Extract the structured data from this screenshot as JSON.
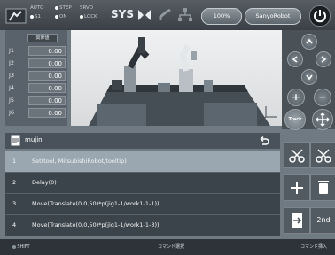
{
  "topbar": {
    "modes": [
      {
        "label": "AUTO",
        "active": false
      },
      {
        "label": "S1",
        "active": true
      },
      {
        "label": "STEP",
        "active": false
      },
      {
        "label": "ON",
        "active": true
      },
      {
        "label": "LOCK",
        "active": false
      },
      {
        "label": "SRVO",
        "active": false
      }
    ],
    "sys_label": "SYS",
    "speed_label": "100%",
    "robot_label": "SanyoRobot"
  },
  "joints": {
    "header": "関節値",
    "items": [
      {
        "label": "J1",
        "value": "0.00"
      },
      {
        "label": "J2",
        "value": "0.00"
      },
      {
        "label": "J3",
        "value": "0.00"
      },
      {
        "label": "J4",
        "value": "0.00"
      },
      {
        "label": "J5",
        "value": "0.00"
      },
      {
        "label": "J6",
        "value": "0.00"
      }
    ]
  },
  "controls": {
    "track_label": "Track",
    "plus": "+",
    "minus": "−"
  },
  "program": {
    "title": "mujin",
    "rows": [
      {
        "num": "1",
        "text": "Set(tool, MitsubishiRobot/tooltip)",
        "selected": true
      },
      {
        "num": "2",
        "text": "Delay(0)",
        "selected": false
      },
      {
        "num": "3",
        "text": "Move(Translate(0,0,50)*p(jig1-1/work1-1-1))",
        "selected": false
      },
      {
        "num": "4",
        "text": "Move(Translate(0,0,50)*p(jig1-1/work1-1-3))",
        "selected": false
      }
    ]
  },
  "tools": {
    "second_label": "2nd"
  },
  "bottombar": {
    "shift_label": "SHIFT",
    "command_select": "コマンド選択",
    "command_insert": "コマンド挿入"
  }
}
